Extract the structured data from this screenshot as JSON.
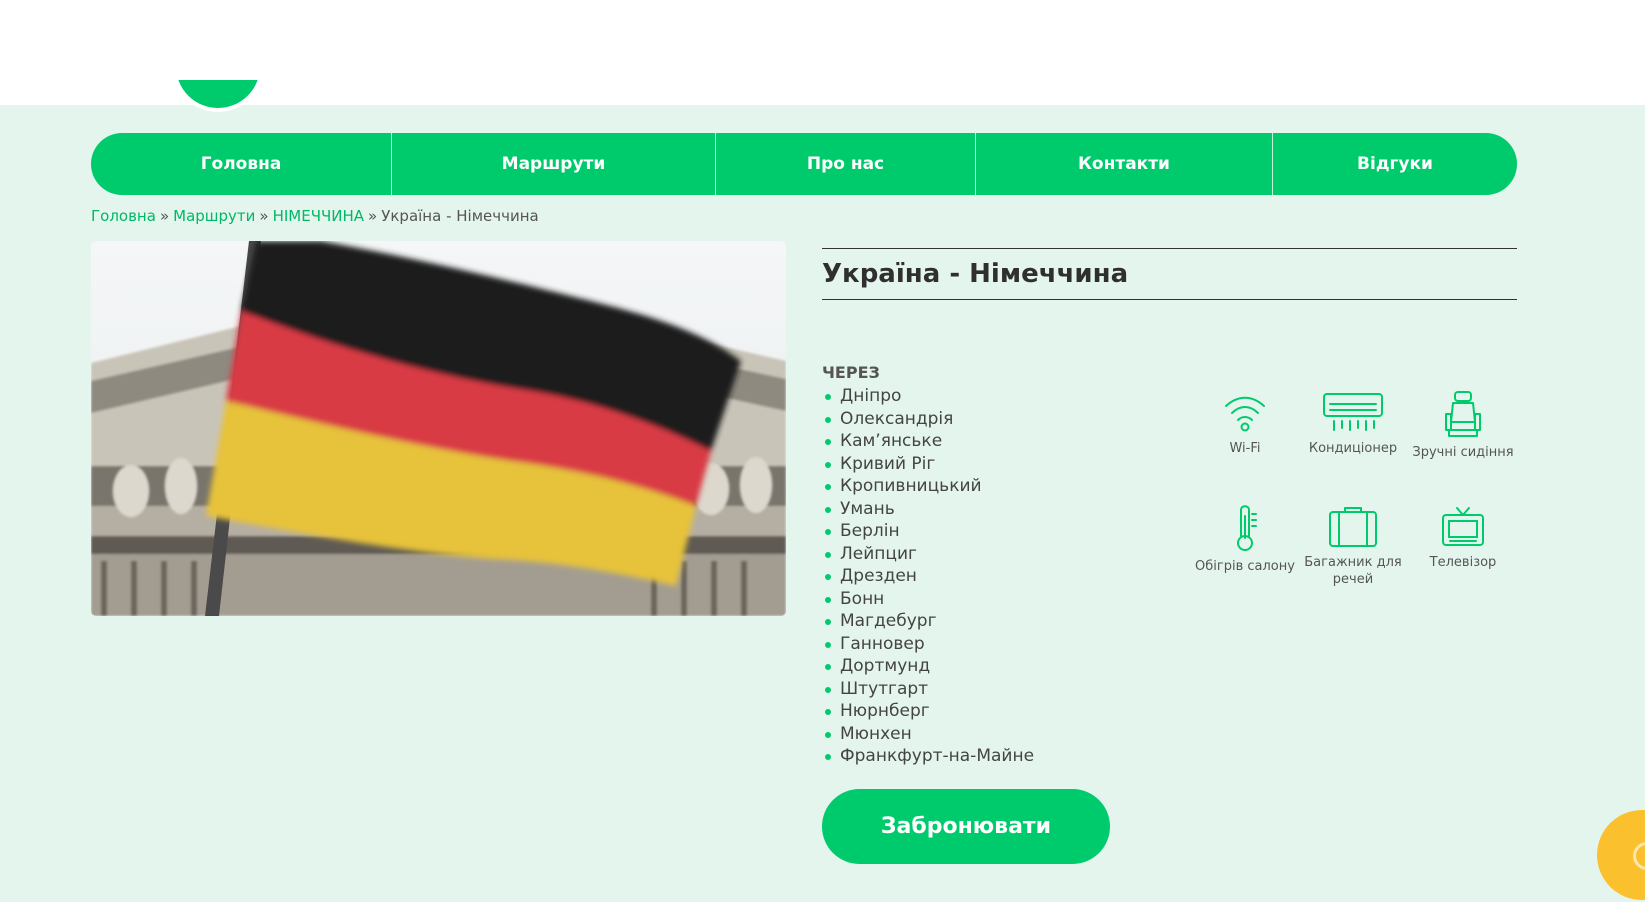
{
  "nav": {
    "items": [
      {
        "label": "Головна"
      },
      {
        "label": "Маршрути"
      },
      {
        "label": "Про нас"
      },
      {
        "label": "Контакти"
      },
      {
        "label": "Відгуки"
      }
    ]
  },
  "breadcrumb": {
    "home": "Головна",
    "routes": "Маршрути",
    "country": "НІМЕЧЧИНА",
    "current": "Україна - Німеччина",
    "separator": "»"
  },
  "route": {
    "title": "Україна - Німеччина",
    "via_label": "ЧЕРЕЗ",
    "stops": [
      "Дніпро",
      "Олександрія",
      "Кам’янське",
      "Кривий Ріг",
      "Кропивницький",
      "Умань",
      "Берлін",
      "Лейпциг",
      "Дрезден",
      "Бонн",
      "Магдебург",
      "Ганновер",
      "Дортмунд",
      "Штутгарт",
      "Нюрнберг",
      "Мюнхен",
      "Франкфурт-на-Майне"
    ]
  },
  "amenities": [
    {
      "label": "Wi-Fi",
      "icon": "wifi-icon"
    },
    {
      "label": "Кондиціонер",
      "icon": "air-conditioner-icon"
    },
    {
      "label": "Зручні сидіння",
      "icon": "seat-icon"
    },
    {
      "label": "Обігрів салону",
      "icon": "thermometer-icon"
    },
    {
      "label": "Багажник для речей",
      "icon": "luggage-icon"
    },
    {
      "label": "Телевізор",
      "icon": "tv-icon"
    }
  ],
  "book_button": {
    "label": "Забронювати"
  },
  "colors": {
    "accent": "#00cb6c",
    "background": "#e4f5ee",
    "chat_widget": "#fbc02d"
  }
}
